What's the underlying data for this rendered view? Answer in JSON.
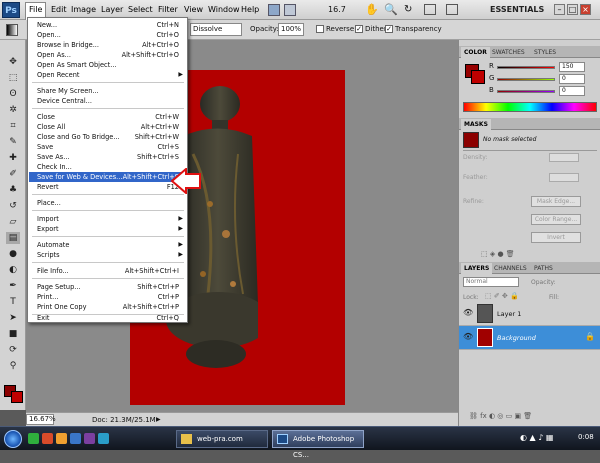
{
  "app": {
    "logo": "Ps",
    "workspace": "ESSENTIALS",
    "zoom_readout": "16.7"
  },
  "menubar": [
    "File",
    "Edit",
    "Image",
    "Layer",
    "Select",
    "Filter",
    "View",
    "Window",
    "Help"
  ],
  "options": {
    "mode": "Dissolve",
    "opacity_label": "Opacity:",
    "opacity": "100%",
    "reverse": "Reverse",
    "dither": "Dither",
    "transparency": "Transparency"
  },
  "file_menu": {
    "items": [
      {
        "label": "New...",
        "shortcut": "Ctrl+N"
      },
      {
        "label": "Open...",
        "shortcut": "Ctrl+O"
      },
      {
        "label": "Browse in Bridge...",
        "shortcut": "Alt+Ctrl+O"
      },
      {
        "label": "Open As...",
        "shortcut": "Alt+Shift+Ctrl+O"
      },
      {
        "label": "Open As Smart Object...",
        "shortcut": ""
      },
      {
        "label": "Open Recent",
        "shortcut": "",
        "submenu": true
      },
      {
        "label": "Share My Screen...",
        "shortcut": ""
      },
      {
        "label": "Device Central...",
        "shortcut": ""
      },
      {
        "label": "Close",
        "shortcut": "Ctrl+W"
      },
      {
        "label": "Close All",
        "shortcut": "Alt+Ctrl+W"
      },
      {
        "label": "Close and Go To Bridge...",
        "shortcut": "Shift+Ctrl+W"
      },
      {
        "label": "Save",
        "shortcut": "Ctrl+S"
      },
      {
        "label": "Save As...",
        "shortcut": "Shift+Ctrl+S"
      },
      {
        "label": "Check In...",
        "shortcut": ""
      },
      {
        "label": "Save for Web & Devices...",
        "shortcut": "Alt+Shift+Ctrl+S",
        "highlighted": true
      },
      {
        "label": "Revert",
        "shortcut": "F12"
      },
      {
        "label": "Place...",
        "shortcut": ""
      },
      {
        "label": "Import",
        "shortcut": "",
        "submenu": true
      },
      {
        "label": "Export",
        "shortcut": "",
        "submenu": true
      },
      {
        "label": "Automate",
        "shortcut": "",
        "submenu": true
      },
      {
        "label": "Scripts",
        "shortcut": "",
        "submenu": true
      },
      {
        "label": "File Info...",
        "shortcut": "Alt+Shift+Ctrl+I"
      },
      {
        "label": "Page Setup...",
        "shortcut": "Shift+Ctrl+P"
      },
      {
        "label": "Print...",
        "shortcut": "Ctrl+P"
      },
      {
        "label": "Print One Copy",
        "shortcut": "Alt+Shift+Ctrl+P"
      },
      {
        "label": "Exit",
        "shortcut": "Ctrl+Q"
      }
    ]
  },
  "status": {
    "zoom": "16.67%",
    "doc_size": "Doc: 21.3M/25.1M"
  },
  "color_panel": {
    "tabs": [
      "COLOR",
      "SWATCHES",
      "STYLES"
    ],
    "r_label": "R",
    "g_label": "G",
    "b_label": "B",
    "r": "150",
    "g": "0",
    "b": "0",
    "fg_color": "#960000"
  },
  "masks_panel": {
    "title": "MASKS",
    "status": "No mask selected",
    "density": "Density:",
    "feather": "Feather:",
    "refine": "Refine:",
    "mask_edge": "Mask Edge...",
    "color_range": "Color Range...",
    "invert": "Invert"
  },
  "layers_panel": {
    "tabs": [
      "LAYERS",
      "CHANNELS",
      "PATHS"
    ],
    "blend": "Normal",
    "opacity_label": "Opacity:",
    "lock_label": "Lock:",
    "fill_label": "Fill:",
    "layers": [
      {
        "name": "Layer 1",
        "selected": false
      },
      {
        "name": "Background",
        "selected": true
      }
    ]
  },
  "taskbar": {
    "tasks": [
      "web-pra.com",
      "Adobe Photoshop CS..."
    ],
    "clock": "0:08"
  }
}
